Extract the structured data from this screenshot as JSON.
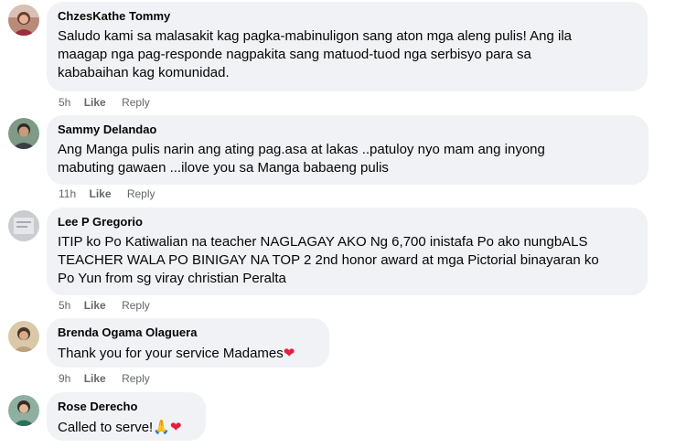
{
  "comments": [
    {
      "author": "ChzesKathe Tommy",
      "lines": [
        "Saludo kami sa malasakit kag pagka-mabinuligon sang aton mga aleng pulis! Ang ila",
        "maagap nga pag-responde nagpakita sang matuod-tuod nga serbisyo para sa",
        "kababaihan kag komunidad."
      ],
      "time": "5h",
      "like_label": "Like",
      "reply_label": "Reply",
      "avatar_icon": "profile-photo"
    },
    {
      "author": "Sammy Delandao",
      "lines": [
        "Ang Manga pulis narin ang ating pag.asa at lakas ..patuloy nyo mam ang inyong",
        "mabuting gawaen ...ilove you sa Manga babaeng pulis"
      ],
      "time": "11h",
      "like_label": "Like",
      "reply_label": "Reply",
      "avatar_icon": "profile-photo"
    },
    {
      "author": "Lee P Gregorio",
      "lines": [
        "ITIP ko Po Katiwalian na teacher NAGLAGAY AKO Ng 6,700 inistafa Po ako nungbALS",
        "TEACHER WALA PO BINIGAY NA TOP 2 2nd honor award at mga Pictorial binayaran ko",
        "Po Yun from sg viray christian Peralta"
      ],
      "time": "5h",
      "like_label": "Like",
      "reply_label": "Reply",
      "avatar_icon": "profile-photo"
    },
    {
      "author": "Brenda Ogama Olaguera",
      "lines": [
        "Thank you for your service Madames"
      ],
      "emoji_after": "❤",
      "time": "9h",
      "like_label": "Like",
      "reply_label": "Reply",
      "avatar_icon": "profile-photo"
    },
    {
      "author": "Rose Derecho",
      "lines": [
        "Called to serve!"
      ],
      "emoji_pray": "🙏",
      "emoji_heart": "❤",
      "time": "",
      "like_label": "",
      "reply_label": "",
      "avatar_icon": "profile-photo"
    }
  ],
  "colors": {
    "bubble": "#f0f2f5",
    "meta": "#65676b",
    "heart": "#e41e3f"
  }
}
